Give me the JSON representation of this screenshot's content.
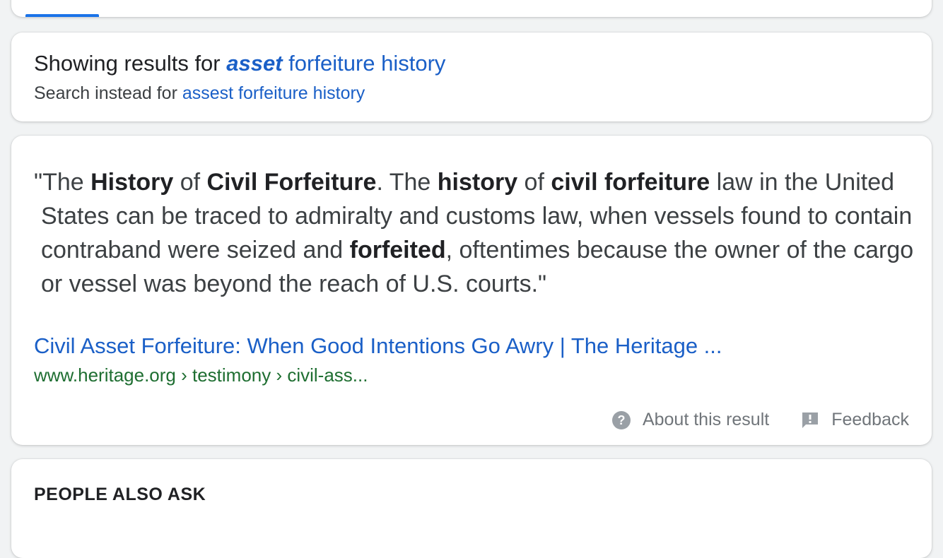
{
  "spelling": {
    "showing_prefix": "Showing results for",
    "corrected_bold": "asset",
    "corrected_rest": "forfeiture history",
    "instead_prefix": "Search instead for",
    "original_query": "assest forfeiture history"
  },
  "snippet": {
    "parts": [
      {
        "t": "\"The ",
        "b": false
      },
      {
        "t": "History",
        "b": true
      },
      {
        "t": " of ",
        "b": false
      },
      {
        "t": "Civil Forfeiture",
        "b": true
      },
      {
        "t": ". The ",
        "b": false
      },
      {
        "t": "history",
        "b": true
      },
      {
        "t": " of ",
        "b": false
      },
      {
        "t": "civil forfeiture",
        "b": true
      },
      {
        "t": " law in the United States can be traced to admiralty and customs law, when vessels found to contain contraband were seized and ",
        "b": false
      },
      {
        "t": "forfeited",
        "b": true
      },
      {
        "t": ", oftentimes because the owner of the cargo or vessel was beyond the reach of U.S. courts.\"",
        "b": false
      }
    ],
    "title": "Civil Asset Forfeiture: When Good Intentions Go Awry | The Heritage ...",
    "url": "www.heritage.org › testimony › civil-ass...",
    "about_label": "About this result",
    "feedback_label": "Feedback"
  },
  "people_also_ask": {
    "heading": "PEOPLE ALSO ASK"
  },
  "colors": {
    "link": "#1a5fc7",
    "url_green": "#1e6e31",
    "tab_indicator": "#1a73e8",
    "muted": "#70757a"
  },
  "icons": {
    "about": "help-circle-icon",
    "feedback": "feedback-icon"
  }
}
